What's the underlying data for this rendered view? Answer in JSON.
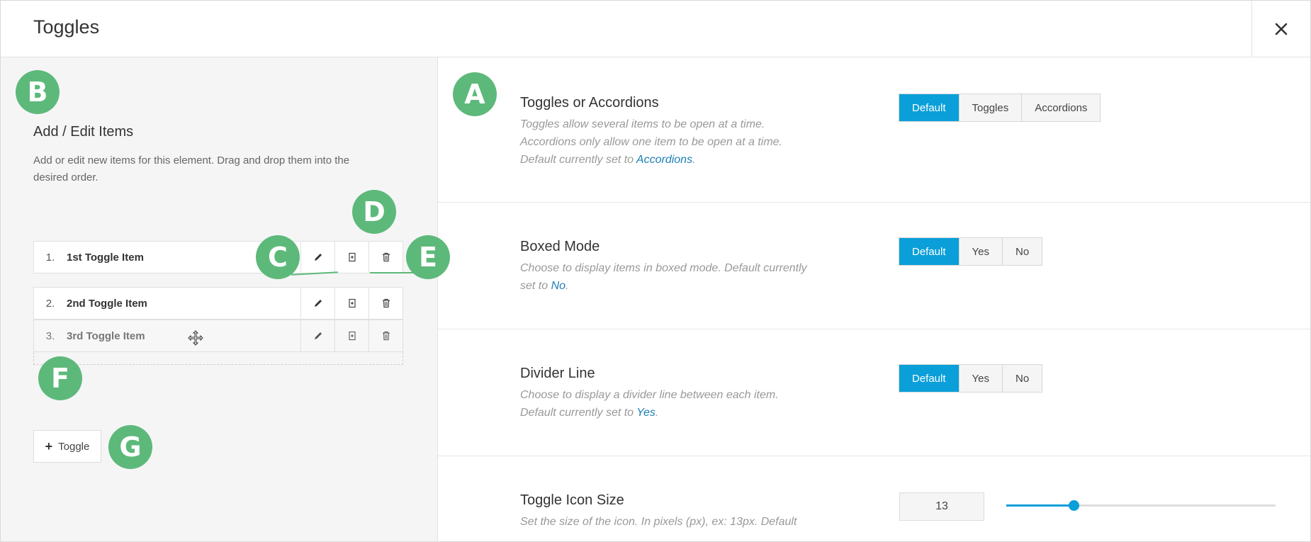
{
  "window": {
    "title": "Toggles"
  },
  "left_panel": {
    "heading": "Add / Edit Items",
    "description": "Add or edit new items for this element. Drag and drop them into the desired order.",
    "items": [
      {
        "number": "1.",
        "label": "1st Toggle Item"
      },
      {
        "number": "2.",
        "label": "2nd Toggle Item"
      },
      {
        "number": "3.",
        "label": "3rd Toggle Item"
      }
    ],
    "add_button_label": "Toggle"
  },
  "badges": {
    "a": "A",
    "b": "B",
    "c": "C",
    "d": "D",
    "e": "E",
    "f": "F",
    "g": "G"
  },
  "options": {
    "toggles_or_accordions": {
      "title": "Toggles or Accordions",
      "desc_line1": "Toggles allow several items to be open at a time.",
      "desc_line2": "Accordions only allow one item to be open at a time.",
      "desc_prefix": "Default currently set to ",
      "desc_link": "Accordions",
      "desc_suffix": ".",
      "buttons": [
        "Default",
        "Toggles",
        "Accordions"
      ]
    },
    "boxed_mode": {
      "title": "Boxed Mode",
      "desc_line1": "Choose to display items in boxed mode. Default currently",
      "desc_prefix": "set to ",
      "desc_link": "No",
      "desc_suffix": ".",
      "buttons": [
        "Default",
        "Yes",
        "No"
      ]
    },
    "divider_line": {
      "title": "Divider Line",
      "desc_line1": "Choose to display a divider line between each item.",
      "desc_prefix": "Default currently set to ",
      "desc_link": "Yes",
      "desc_suffix": ".",
      "buttons": [
        "Default",
        "Yes",
        "No"
      ]
    },
    "toggle_icon_size": {
      "title": "Toggle Icon Size",
      "desc_line1": "Set the size of the icon. In pixels (px), ex: 13px. Default",
      "value": "13",
      "slider_fraction": 0.25
    }
  },
  "colors": {
    "accent": "#0a9fd8",
    "badge": "#5db97a",
    "link": "#1c7fb5"
  }
}
